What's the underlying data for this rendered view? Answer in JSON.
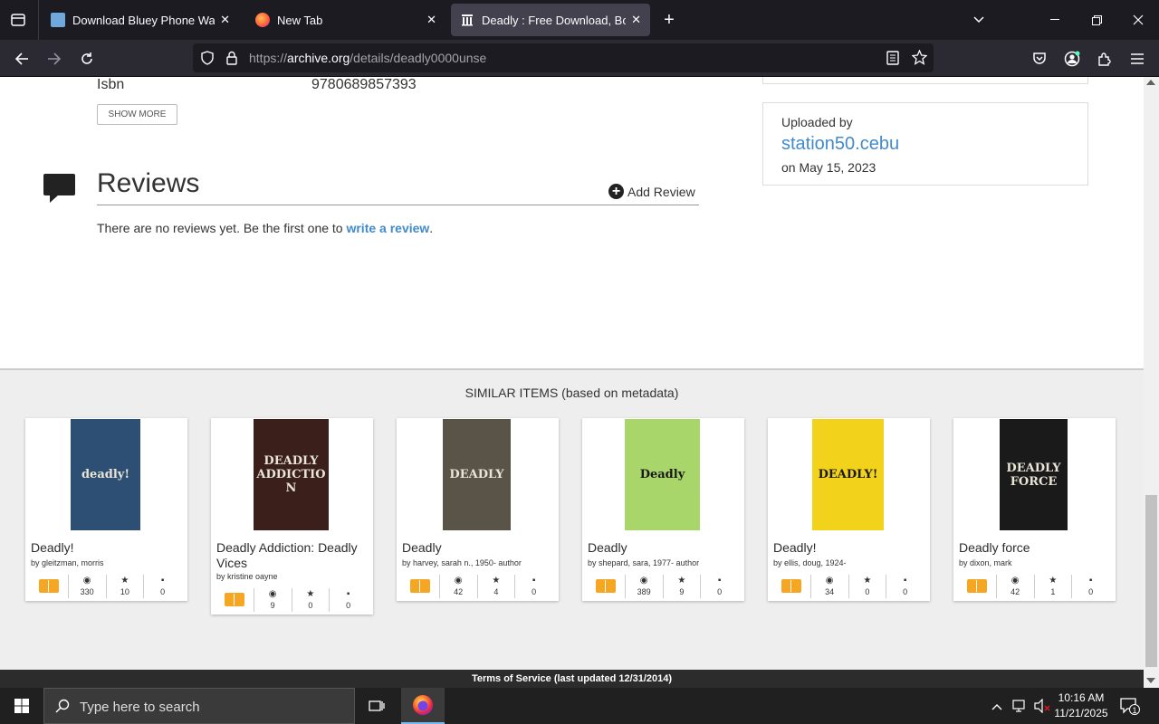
{
  "browser": {
    "tabs": [
      {
        "title": "Download Bluey Phone Wallpap",
        "active": false
      },
      {
        "title": "New Tab",
        "active": false
      },
      {
        "title": "Deadly : Free Download, Borrow",
        "active": true
      }
    ],
    "url_prefix": "https://",
    "url_domain": "archive.org",
    "url_path": "/details/deadly0000unse"
  },
  "metadata": {
    "isbn_label": "Isbn",
    "isbn_value": "9780689857393",
    "show_more": "SHOW MORE"
  },
  "uploader": {
    "label": "Uploaded by",
    "name": "station50.cebu",
    "date": "on May 15, 2023"
  },
  "reviews": {
    "heading": "Reviews",
    "add_review": "Add Review",
    "empty_text": "There are no reviews yet. Be the first one to",
    "write_link": "write a review",
    "period": "."
  },
  "similar": {
    "heading": "SIMILAR ITEMS (based on metadata)",
    "items": [
      {
        "title": "Deadly!",
        "by": "by gleitzman, morris",
        "views": "330",
        "favs": "10",
        "reviews": "0",
        "cover_text": "deadly!",
        "cover_color": "#2d4f73"
      },
      {
        "title": "Deadly Addiction: Deadly Vices",
        "by": "by kristine oayne",
        "views": "9",
        "favs": "0",
        "reviews": "0",
        "cover_text": "DEADLY ADDICTION",
        "cover_color": "#3a1f1a"
      },
      {
        "title": "Deadly",
        "by": "by harvey, sarah n., 1950- author",
        "views": "42",
        "favs": "4",
        "reviews": "0",
        "cover_text": "DEADLY",
        "cover_color": "#5a5448"
      },
      {
        "title": "Deadly",
        "by": "by shepard, sara, 1977- author",
        "views": "389",
        "favs": "9",
        "reviews": "0",
        "cover_text": "Deadly",
        "cover_color": "#a8d66a"
      },
      {
        "title": "Deadly!",
        "by": "by ellis, doug, 1924-",
        "views": "34",
        "favs": "0",
        "reviews": "0",
        "cover_text": "DEADLY!",
        "cover_color": "#f2d21a"
      },
      {
        "title": "Deadly force",
        "by": "by dixon, mark",
        "views": "42",
        "favs": "1",
        "reviews": "0",
        "cover_text": "DEADLY FORCE",
        "cover_color": "#1a1a1a"
      }
    ]
  },
  "footer": {
    "terms": "Terms of Service (last updated 12/31/2014)"
  },
  "taskbar": {
    "search_placeholder": "Type here to search",
    "time": "10:16 AM",
    "date": "11/21/2025",
    "notification_count": "1"
  }
}
